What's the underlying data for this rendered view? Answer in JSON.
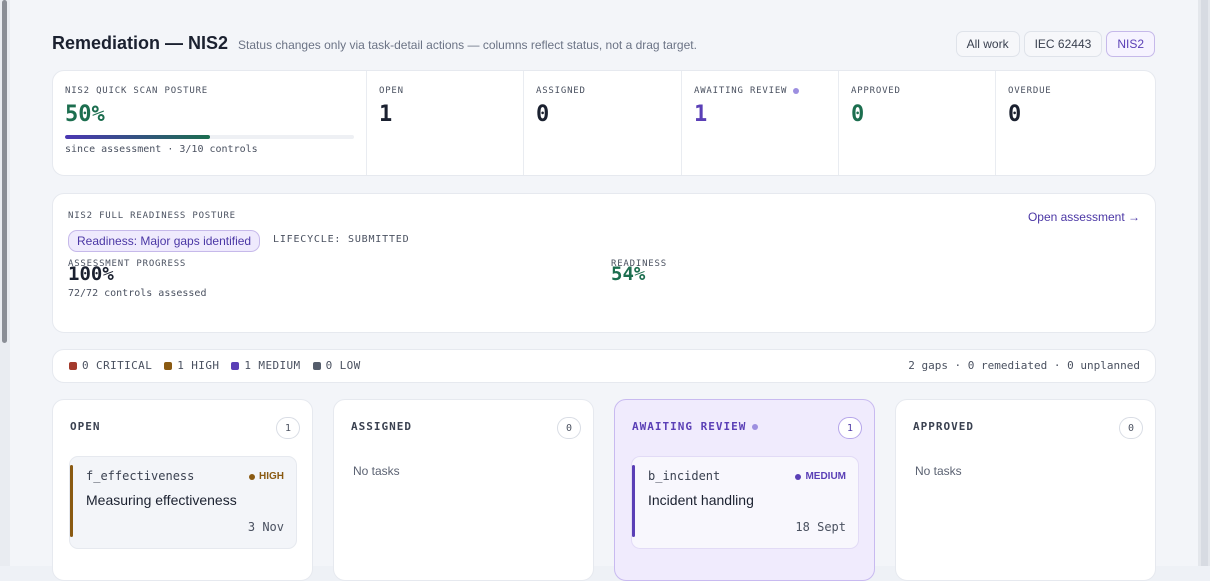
{
  "header": {
    "title": "Remediation — NIS2",
    "subtitle": "Status changes only via task-detail actions — columns reflect status, not a drag target.",
    "filters": [
      {
        "label": "All work",
        "active": false
      },
      {
        "label": "IEC 62443",
        "active": false
      },
      {
        "label": "NIS2",
        "active": true
      }
    ]
  },
  "quick_scan": {
    "label": "NIS2 QUICK SCAN POSTURE",
    "value": "50%",
    "progress": 0.5,
    "note": "since assessment · 3/10 controls"
  },
  "stats": [
    {
      "label": "OPEN",
      "value": "1"
    },
    {
      "label": "ASSIGNED",
      "value": "0"
    },
    {
      "label": "AWAITING REVIEW",
      "value": "1"
    },
    {
      "label": "APPROVED",
      "value": "0"
    },
    {
      "label": "OVERDUE",
      "value": "0"
    }
  ],
  "full_readiness": {
    "label": "NIS2 FULL READINESS POSTURE",
    "readiness_pill": "Readiness: Major gaps identified",
    "lifecycle": "LIFECYCLE: SUBMITTED",
    "open_link": "Open assessment →",
    "assessment_progress_label": "ASSESSMENT PROGRESS",
    "assessment_progress_value": "100%",
    "controls_assessed": "72/72 controls assessed",
    "readiness_label": "READINESS",
    "readiness_value": "54%"
  },
  "severity": {
    "items": [
      {
        "label": "0 CRITICAL",
        "color": "#a33a2c"
      },
      {
        "label": "1 HIGH",
        "color": "#8a5a12"
      },
      {
        "label": "1 MEDIUM",
        "color": "#5a3fb6"
      },
      {
        "label": "0 LOW",
        "color": "#555d6b"
      }
    ],
    "summary": "2 gaps · 0 remediated · 0 unplanned"
  },
  "columns": [
    {
      "title": "OPEN",
      "count": "1",
      "task": {
        "id": "f_effectiveness",
        "severity": "HIGH",
        "severity_color": "#8a5a12",
        "title": "Measuring effectiveness",
        "date": "3 Nov"
      }
    },
    {
      "title": "ASSIGNED",
      "count": "0",
      "empty_text": "No tasks"
    },
    {
      "title": "AWAITING REVIEW",
      "count": "1",
      "task": {
        "id": "b_incident",
        "severity": "MEDIUM",
        "severity_color": "#5a3fb6",
        "title": "Incident handling",
        "date": "18 Sept"
      }
    },
    {
      "title": "APPROVED",
      "count": "0",
      "empty_text": "No tasks"
    }
  ],
  "colors": {
    "positive": "#1c6e4f",
    "review": "#5a3fb6",
    "dark": "#1b2130"
  }
}
